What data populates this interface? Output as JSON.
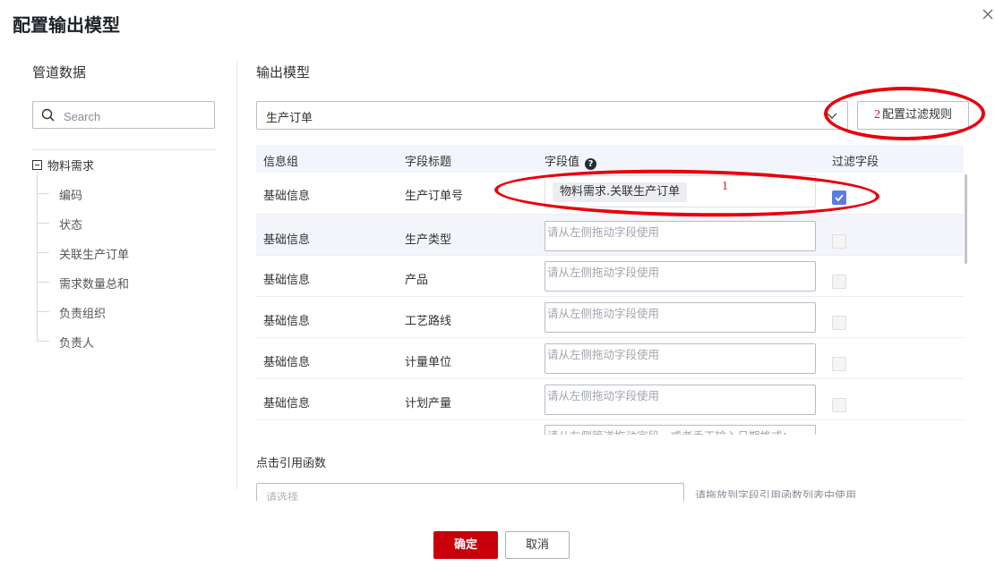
{
  "dialog": {
    "title": "配置输出模型"
  },
  "left": {
    "title": "管道数据",
    "search_placeholder": "Search",
    "root": "物料需求",
    "items": [
      "编码",
      "状态",
      "关联生产订单",
      "需求数量总和",
      "负责组织",
      "负责人"
    ]
  },
  "right": {
    "title": "输出模型",
    "model_select": "生产订单",
    "filter_button_num": "2",
    "filter_button": "配置过滤规则",
    "columns": [
      "信息组",
      "字段标题",
      "字段值",
      "过滤字段"
    ],
    "rows": [
      {
        "group": "基础信息",
        "title": "生产订单号",
        "value": "物料需求.关联生产订单",
        "placeholder": "",
        "checked": true
      },
      {
        "group": "基础信息",
        "title": "生产类型",
        "value": "",
        "placeholder": "请从左侧拖动字段使用",
        "checked": false
      },
      {
        "group": "基础信息",
        "title": "产品",
        "value": "",
        "placeholder": "请从左侧拖动字段使用",
        "checked": false
      },
      {
        "group": "基础信息",
        "title": "工艺路线",
        "value": "",
        "placeholder": "请从左侧拖动字段使用",
        "checked": false
      },
      {
        "group": "基础信息",
        "title": "计量单位",
        "value": "",
        "placeholder": "请从左侧拖动字段使用",
        "checked": false
      },
      {
        "group": "基础信息",
        "title": "计划产量",
        "value": "",
        "placeholder": "请从左侧拖动字段使用",
        "checked": false
      }
    ],
    "partial_row_placeholder": "请从左侧管道拖动字段，或者手工输入日期格式：",
    "annotation_1": "1",
    "func_label": "点击引用函数",
    "func_input_placeholder": "请选择",
    "func_hint": "请拖放到字段引用函数列表中使用"
  },
  "footer": {
    "ok": "确定",
    "cancel": "取消"
  },
  "colors": {
    "primary": "#c7000b",
    "annotation": "#e8000b",
    "checkbox": "#5e7ce0"
  }
}
